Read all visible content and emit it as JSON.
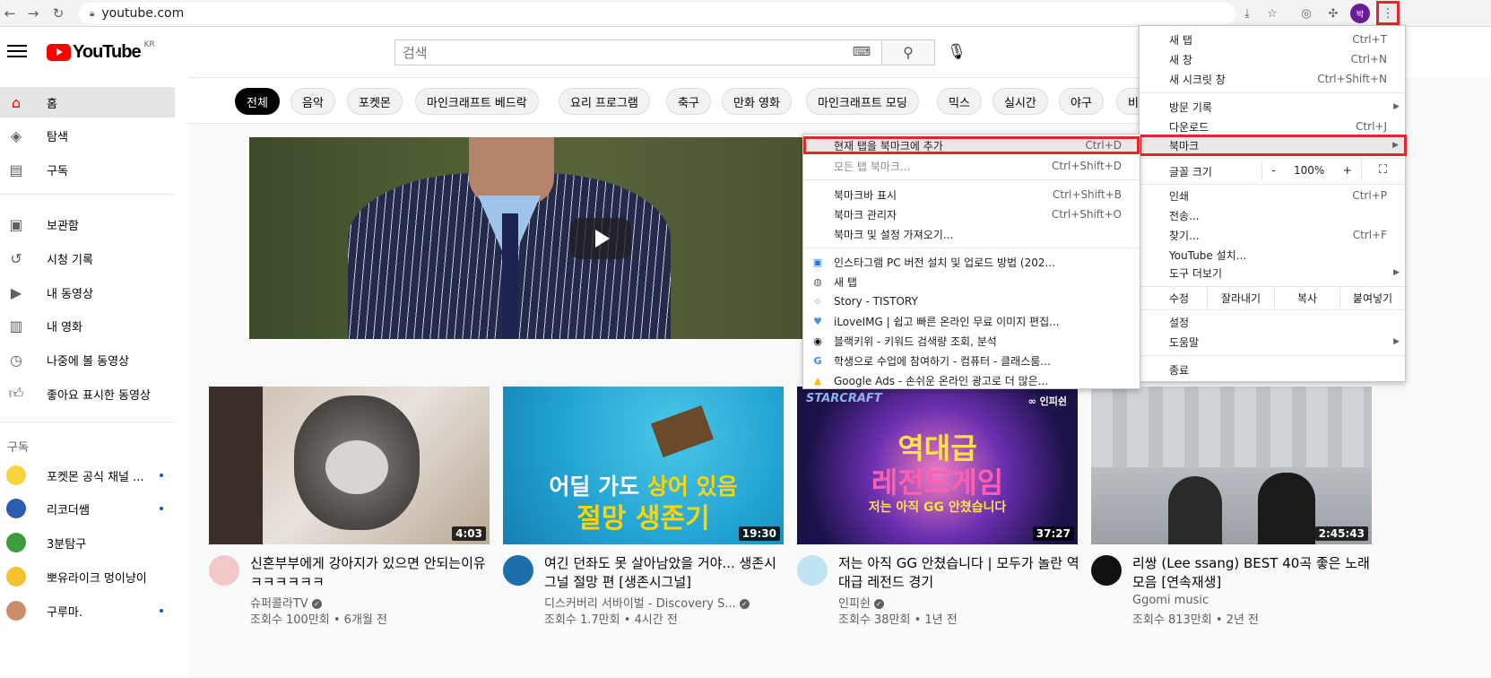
{
  "browser": {
    "url": "youtube.com",
    "profile_initial": "박"
  },
  "header": {
    "logo_text": "YouTube",
    "country_code": "KR",
    "search_placeholder": "검색"
  },
  "sidebar": {
    "items": [
      {
        "label": "홈",
        "icon": "home-icon"
      },
      {
        "label": "탐색",
        "icon": "compass-icon"
      },
      {
        "label": "구독",
        "icon": "subscriptions-icon"
      },
      {
        "label": "보관함",
        "icon": "library-icon"
      },
      {
        "label": "시청 기록",
        "icon": "history-icon"
      },
      {
        "label": "내 동영상",
        "icon": "my-videos-icon"
      },
      {
        "label": "내 영화",
        "icon": "movies-icon"
      },
      {
        "label": "나중에 볼 동영상",
        "icon": "watch-later-icon"
      },
      {
        "label": "좋아요 표시한 동영상",
        "icon": "like-icon"
      }
    ],
    "subscriptions_heading": "구독",
    "subscriptions": [
      {
        "label": "포켓몬 공식 채널 ..."
      },
      {
        "label": "리코더쌤"
      },
      {
        "label": "3분탐구"
      },
      {
        "label": "뽀유라이크 멍이냥이"
      },
      {
        "label": "구루마."
      }
    ]
  },
  "chips": [
    "전체",
    "음악",
    "포켓몬",
    "마인크래프트 베드락",
    "요리 프로그램",
    "축구",
    "만화 영화",
    "마인크래프트 모딩",
    "믹스",
    "실시간",
    "야구",
    "비"
  ],
  "videos": [
    {
      "title": "신혼부부에게 강아지가 있으면 안되는이유ㅋㅋㅋㅋㅋㅋ",
      "channel": "슈퍼콜라TV",
      "meta": "조회수 100만회 • 6개월 전",
      "duration": "4:03"
    },
    {
      "title": "여긴 던좌도 못 살아남았을 거야... 생존시그널 절망 편 [생존시그널]",
      "channel": "디스커버리 서바이벌 - Discovery S...",
      "meta": "조회수 1.7만회 • 4시간 전",
      "duration": "19:30",
      "thumb_text_1": "어딜 가도",
      "thumb_text_2": "상어 있음",
      "thumb_text_3": "절망 생존기"
    },
    {
      "title": "저는 아직 GG 안쳤습니다 | 모두가 놀란 역대급 레전드 경기",
      "channel": "인피쉰",
      "meta": "조회수 38만회 • 1년 전",
      "duration": "37:27",
      "thumb_text_1": "역대급",
      "thumb_text_2": "레전드게임",
      "thumb_text_3": "저는 아직 GG 안쳤습니다",
      "thumb_brand": "STARCRAFT",
      "thumb_brand2": "∞ 인피쉰"
    },
    {
      "title": "리쌍 (Lee ssang) BEST 40곡 좋은 노래모음 [연속재생]",
      "channel": "Ggomi music",
      "meta": "조회수 813만회 • 2년 전",
      "duration": "2:45:43"
    }
  ],
  "chrome_menu": {
    "items_top": [
      {
        "label": "새 탭",
        "shortcut": "Ctrl+T"
      },
      {
        "label": "새 창",
        "shortcut": "Ctrl+N"
      },
      {
        "label": "새 시크릿 창",
        "shortcut": "Ctrl+Shift+N"
      }
    ],
    "items_mid": [
      {
        "label": "방문 기록",
        "shortcut": ""
      },
      {
        "label": "다운로드",
        "shortcut": "Ctrl+J"
      },
      {
        "label": "북마크",
        "shortcut": ""
      }
    ],
    "zoom_label": "글꼴 크기",
    "zoom_minus": "-",
    "zoom_value": "100%",
    "zoom_plus": "+",
    "items_tools": [
      {
        "label": "인쇄",
        "shortcut": "Ctrl+P"
      },
      {
        "label": "전송...",
        "shortcut": ""
      },
      {
        "label": "찾기...",
        "shortcut": "Ctrl+F"
      },
      {
        "label": "YouTube 설치...",
        "shortcut": ""
      },
      {
        "label": "도구 더보기",
        "shortcut": ""
      }
    ],
    "edit_label": "수정",
    "edit_cut": "잘라내기",
    "edit_copy": "복사",
    "edit_paste": "붙여넣기",
    "items_bottom": [
      {
        "label": "설정"
      },
      {
        "label": "도움말"
      }
    ],
    "exit_label": "종료"
  },
  "bookmark_menu": {
    "add_current": {
      "label": "현재 탭을 북마크에 추가",
      "shortcut": "Ctrl+D"
    },
    "add_all": {
      "label": "모든 탭 북마크...",
      "shortcut": "Ctrl+Shift+D"
    },
    "show_bar": {
      "label": "북마크바 표시",
      "shortcut": "Ctrl+Shift+B"
    },
    "manager": {
      "label": "북마크 관리자",
      "shortcut": "Ctrl+Shift+O"
    },
    "import": {
      "label": "북마크 및 설정 가져오기...",
      "shortcut": ""
    },
    "bookmarks": [
      {
        "label": "인스타그램 PC 버전 설치 및 업로드 방법 (202...",
        "icon": "instagram-favicon"
      },
      {
        "label": "새 탭",
        "icon": "globe-favicon"
      },
      {
        "label": "Story - TISTORY",
        "icon": "tistory-favicon"
      },
      {
        "label": "iLoveIMG | 쉽고 빠른 온라인 무료 이미지 편집...",
        "icon": "iloveimg-favicon"
      },
      {
        "label": "블랙키위 - 키워드 검색량 조회, 분석",
        "icon": "blackkiwi-favicon"
      },
      {
        "label": "학생으로 수업에 참여하기 - 컴퓨터 - 클래스룸...",
        "icon": "google-favicon"
      },
      {
        "label": "Google Ads - 손쉬운 온라인 광고로 더 많은...",
        "icon": "google-ads-favicon"
      }
    ]
  },
  "colors": {
    "yt_red": "#ff0000",
    "highlight_red": "#e2262c",
    "link_blue": "#065fd4"
  }
}
